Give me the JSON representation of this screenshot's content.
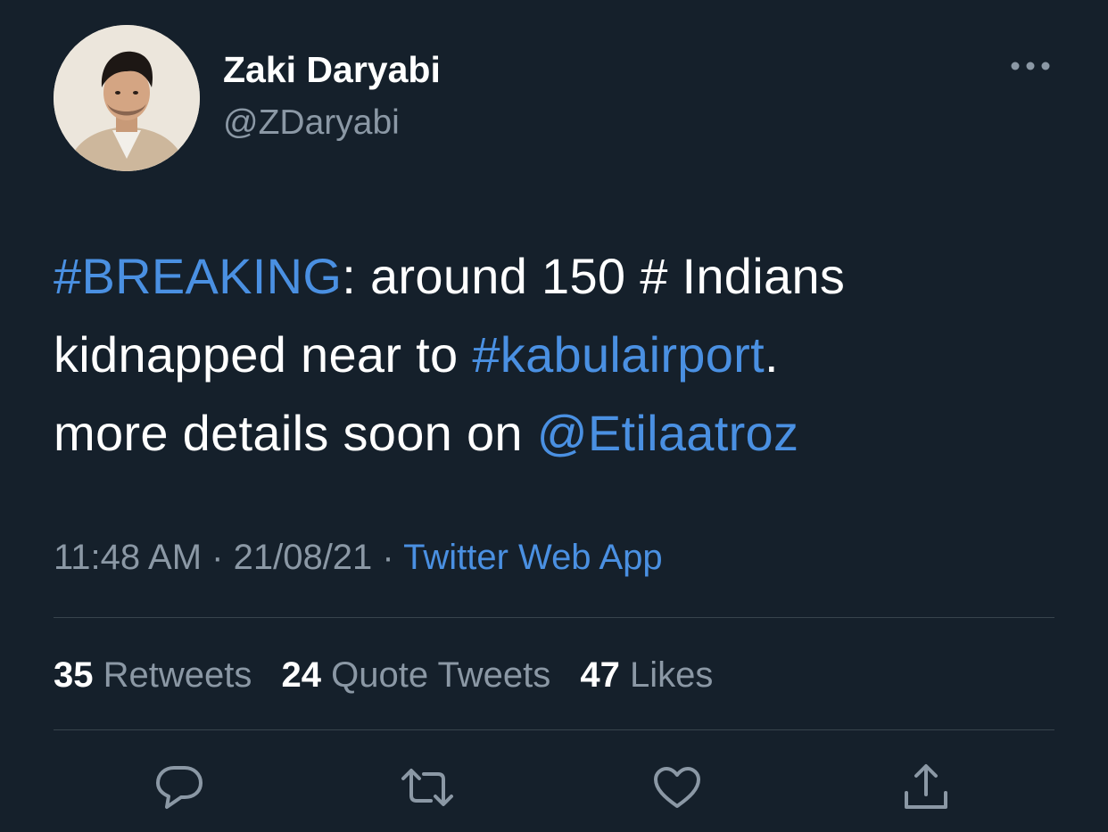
{
  "author": {
    "display_name": "Zaki Daryabi",
    "handle": "@ZDaryabi"
  },
  "tweet": {
    "line1": {
      "hashtag": "#BREAKING",
      "text": ": around 150 # Indians"
    },
    "line2": {
      "text": "kidnapped near to ",
      "hashtag": "#kabulairport",
      "trailing": "."
    },
    "line3": {
      "text": "more details soon on ",
      "mention": "@Etilaatroz"
    }
  },
  "meta": {
    "time": "11:48 AM",
    "separator1": " · ",
    "date": "21/08/21",
    "separator2": " · ",
    "source": "Twitter Web App"
  },
  "stats": {
    "retweets": {
      "count": "35",
      "label": "Retweets"
    },
    "quote_tweets": {
      "count": "24",
      "label": "Quote Tweets"
    },
    "likes": {
      "count": "47",
      "label": "Likes"
    }
  },
  "icons": {
    "more": "more-horizontal-icon",
    "reply": "reply-icon",
    "retweet": "retweet-icon",
    "like": "heart-icon",
    "share": "share-icon"
  },
  "colors": {
    "background": "#15202b",
    "link": "#4a90e2",
    "secondary_text": "#8b98a5",
    "divider": "#38444d"
  }
}
